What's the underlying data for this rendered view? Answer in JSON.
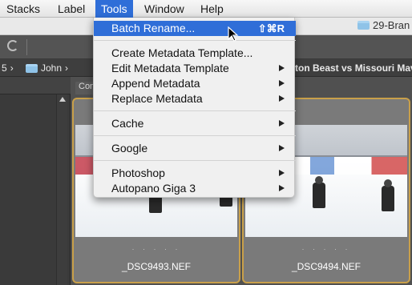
{
  "menubar": {
    "items": [
      "Stacks",
      "Label",
      "Tools",
      "Window",
      "Help"
    ],
    "active": "Tools"
  },
  "window": {
    "title": "29-Bran"
  },
  "breadcrumb": {
    "lead": "5",
    "folder": "John",
    "trail": "ton Beast vs Missouri Mavi"
  },
  "content": {
    "tab": "Con"
  },
  "menu": {
    "batch_rename": {
      "label": "Batch Rename...",
      "shortcut": "⇧⌘R"
    },
    "create_template": "Create Metadata Template...",
    "edit_template": "Edit Metadata Template",
    "append": "Append Metadata",
    "replace": "Replace Metadata",
    "cache": "Cache",
    "google": "Google",
    "photoshop": "Photoshop",
    "autopano": "Autopano Giga 3"
  },
  "thumbnails": [
    {
      "filename": "_DSC9493.NEF",
      "rating": "· · · · ·"
    },
    {
      "filename": "_DSC9494.NEF",
      "rating": "· · · · ·"
    }
  ],
  "colors": {
    "highlight": "#2f6ed8",
    "selection_border": "#c9a04a"
  }
}
